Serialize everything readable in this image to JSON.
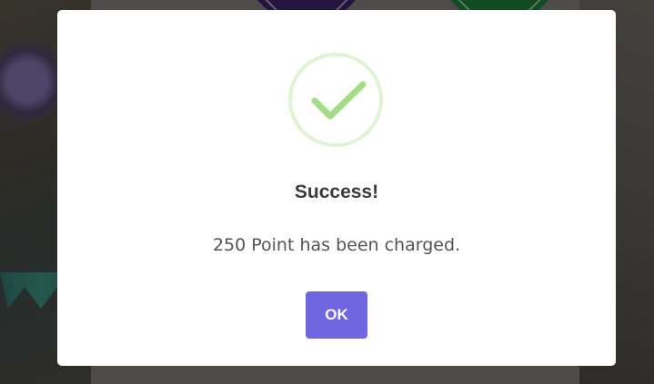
{
  "dialog": {
    "title": "Success!",
    "message": "250 Point has been charged.",
    "confirm_label": "OK",
    "icon": "check-icon"
  },
  "colors": {
    "confirm_button": "#7066e0",
    "success_icon": "#a5dc86",
    "overlay": "rgba(0,0,0,0.38)"
  }
}
